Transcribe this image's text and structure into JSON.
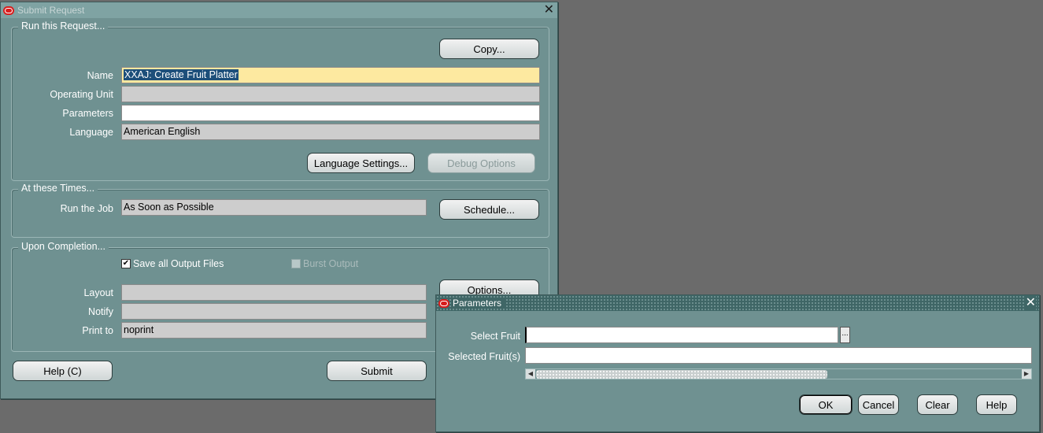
{
  "submit_window": {
    "title": "Submit Request",
    "run_group": {
      "label": "Run this Request...",
      "copy_button": "Copy...",
      "name_label": "Name",
      "name_value": "XXAJ: Create Fruit Platter",
      "operating_unit_label": "Operating Unit",
      "operating_unit_value": "",
      "parameters_label": "Parameters",
      "parameters_value": "",
      "language_label": "Language",
      "language_value": "American English",
      "language_settings_button": "Language Settings...",
      "debug_options_button": "Debug Options"
    },
    "times_group": {
      "label": "At these Times...",
      "run_job_label": "Run the Job",
      "run_job_value": "As Soon as Possible",
      "schedule_button": "Schedule..."
    },
    "completion_group": {
      "label": "Upon Completion...",
      "save_output_label": "Save all Output Files",
      "save_output_checked": true,
      "burst_output_label": "Burst Output",
      "burst_output_checked": false,
      "options_button": "Options...",
      "layout_label": "Layout",
      "layout_value": "",
      "notify_label": "Notify",
      "notify_value": "",
      "print_to_label": "Print to",
      "print_to_value": "noprint"
    },
    "help_button": "Help (C)",
    "submit_button": "Submit"
  },
  "parameters_window": {
    "title": "Parameters",
    "select_fruit_label": "Select Fruit",
    "select_fruit_value": "",
    "selected_fruits_label": "Selected Fruit(s)",
    "selected_fruits_value": "",
    "lov_button": "...",
    "ok_button": "OK",
    "cancel_button": "Cancel",
    "clear_button": "Clear",
    "help_button": "Help"
  },
  "colors": {
    "window_bg": "#6f9191",
    "desktop_bg": "#6b6b6b",
    "name_field_bg": "#fde9a0",
    "selection_bg": "#1d4f7a"
  }
}
